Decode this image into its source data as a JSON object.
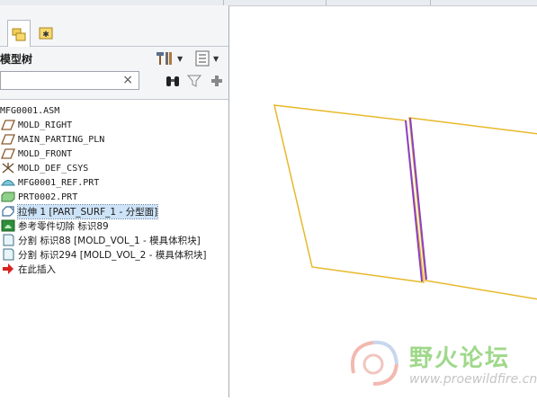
{
  "panel": {
    "title": "模型树",
    "search": {
      "value": "",
      "clear_glyph": "×"
    },
    "toolbar_icons": [
      "tools-icon",
      "columns-icon",
      "binoculars-icon",
      "filter-icon",
      "plus-icon"
    ],
    "tabs": [
      {
        "icon": "folder-tree-icon",
        "active": true
      },
      {
        "icon": "folder-star-icon",
        "active": false
      }
    ]
  },
  "tree": {
    "items": [
      {
        "label": "MFG0001.ASM",
        "icon": "assembly-icon"
      },
      {
        "label": "MOLD_RIGHT",
        "icon": "datum-plane-icon"
      },
      {
        "label": "MAIN_PARTING_PLN",
        "icon": "datum-plane-icon"
      },
      {
        "label": "MOLD_FRONT",
        "icon": "datum-plane-icon"
      },
      {
        "label": "MOLD_DEF_CSYS",
        "icon": "csys-icon"
      },
      {
        "label": "MFG0001_REF.PRT",
        "icon": "ref-part-icon"
      },
      {
        "label": "PRT0002.PRT",
        "icon": "workpiece-icon"
      },
      {
        "label": "拉伸 1 [PART_SURF_1 - 分型面]",
        "icon": "extrude-icon",
        "selected": true
      },
      {
        "label": "参考零件切除 标识89",
        "icon": "ref-cut-icon"
      },
      {
        "label": "分割 标识88 [MOLD_VOL_1 - 模具体积块]",
        "icon": "split-icon"
      },
      {
        "label": "分割 标识294 [MOLD_VOL_2 - 模具体积块]",
        "icon": "split-icon"
      },
      {
        "label": "在此插入",
        "icon": "insert-here-icon"
      }
    ]
  },
  "watermark": {
    "text": "野火论坛",
    "url": "www.proewildfire.cn"
  },
  "colors": {
    "surface_edge": "#e8b82a",
    "highlight_edge": "#8a3fc7",
    "selection_bg": "#cde3f7"
  }
}
